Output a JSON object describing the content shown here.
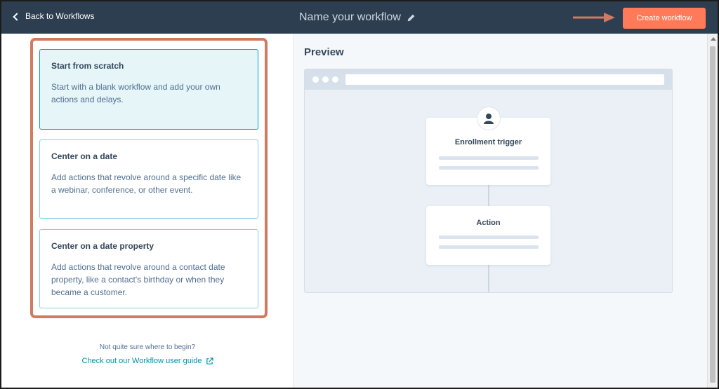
{
  "header": {
    "back_label": "Back to Workflows",
    "title": "Name your workflow",
    "create_label": "Create workflow",
    "colors": {
      "bar": "#2d3e50",
      "button": "#ff7a59",
      "annotation": "#d17a62"
    }
  },
  "options": [
    {
      "title": "Start from scratch",
      "description": "Start with a blank workflow and add your own actions and delays.",
      "selected": true
    },
    {
      "title": "Center on a date",
      "description": "Add actions that revolve around a specific date like a webinar, conference, or other event.",
      "selected": false
    },
    {
      "title": "Center on a date property",
      "description": "Add actions that revolve around a contact date property, like a contact's birthday or when they became a customer.",
      "selected": false
    }
  ],
  "help": {
    "question": "Not quite sure where to begin?",
    "link": "Check out our Workflow user guide"
  },
  "preview": {
    "title": "Preview",
    "trigger_label": "Enrollment trigger",
    "action_label": "Action"
  },
  "icons": {
    "back": "chevron-left-icon",
    "edit": "pencil-icon",
    "external": "external-link-icon",
    "contact": "user-icon",
    "annotation": "arrow-right-icon"
  }
}
